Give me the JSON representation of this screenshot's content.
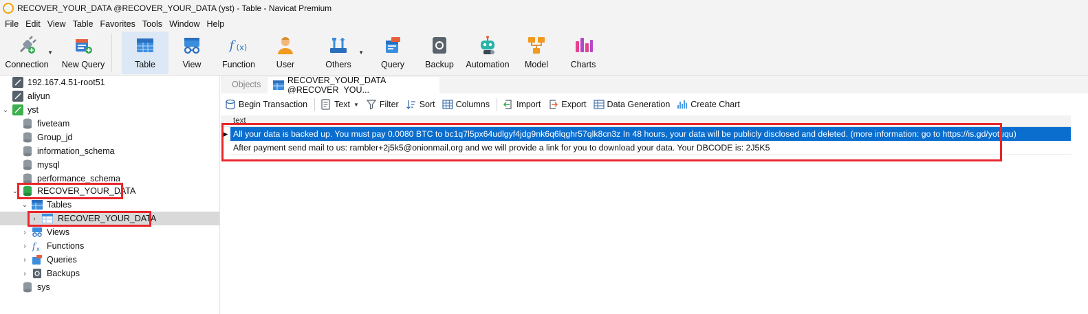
{
  "window": {
    "title": "RECOVER_YOUR_DATA @RECOVER_YOUR_DATA (yst) - Table - Navicat Premium"
  },
  "menu": [
    "File",
    "Edit",
    "View",
    "Table",
    "Favorites",
    "Tools",
    "Window",
    "Help"
  ],
  "toolbar": {
    "connection": "Connection",
    "new_query": "New Query",
    "table": "Table",
    "view": "View",
    "function": "Function",
    "user": "User",
    "others": "Others",
    "query": "Query",
    "backup": "Backup",
    "automation": "Automation",
    "model": "Model",
    "charts": "Charts"
  },
  "tree": {
    "conn1": "192.167.4.51-root51",
    "conn2": "aliyun",
    "conn3": "yst",
    "db_fiveteam": "fiveteam",
    "db_group": "Group_jd",
    "db_info": "information_schema",
    "db_mysql": "mysql",
    "db_perf": "performance_schema",
    "db_recover": "RECOVER_YOUR_DATA",
    "tables": "Tables",
    "table_recover": "RECOVER_YOUR_DATA",
    "views": "Views",
    "functions": "Functions",
    "queries": "Queries",
    "backups": "Backups",
    "db_sys": "sys"
  },
  "tabs": {
    "objects": "Objects",
    "table_tab": "RECOVER_YOUR_DATA @RECOVER_YOU..."
  },
  "actions": {
    "begin_transaction": "Begin Transaction",
    "text": "Text",
    "filter": "Filter",
    "sort": "Sort",
    "columns": "Columns",
    "import": "Import",
    "export": "Export",
    "data_generation": "Data Generation",
    "create_chart": "Create Chart"
  },
  "grid": {
    "column": "text",
    "rows": [
      "All your data is backed up. You must pay 0.0080 BTC to bc1q7l5px64udlgyf4jdg9nk6q6lqghr57qlk8cn3z In 48 hours, your data will be publicly disclosed and deleted. (more information: go to https://is.gd/yotuqu)",
      "After payment send mail to us: rambler+2j5k5@onionmail.org and we will provide a link for you to download your data. Your DBCODE is: 2J5K5"
    ]
  },
  "colors": {
    "selection": "#0a6ecf",
    "highlight": "#e8262b",
    "toolbar_bg": "#f3f3f3"
  }
}
